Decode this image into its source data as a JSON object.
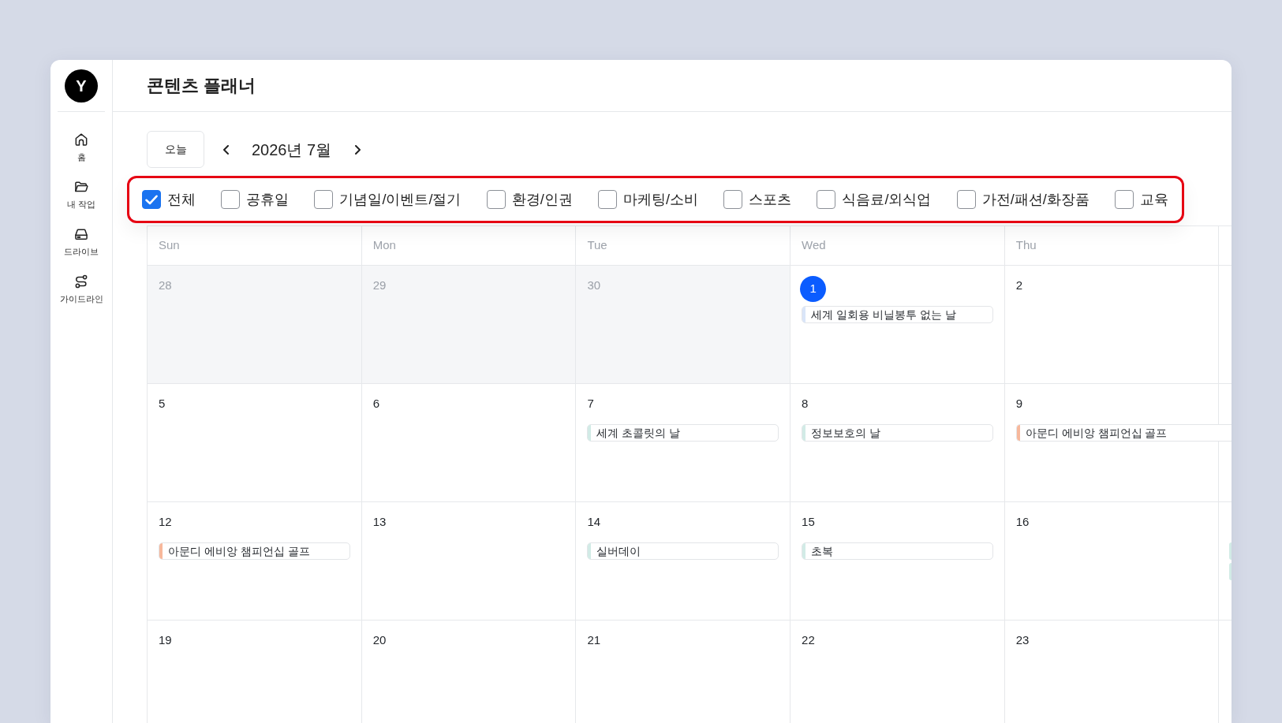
{
  "sidebar": {
    "avatar": "Y",
    "items": [
      {
        "label": "홈"
      },
      {
        "label": "내 작업"
      },
      {
        "label": "드라이브"
      },
      {
        "label": "가이드라인"
      }
    ]
  },
  "header": {
    "title": "콘텐츠 플래너"
  },
  "toolbar": {
    "today_button": "오늘",
    "month": "2026년 7월"
  },
  "filters": [
    {
      "label": "전체",
      "checked": true
    },
    {
      "label": "공휴일",
      "checked": false
    },
    {
      "label": "기념일/이벤트/절기",
      "checked": false
    },
    {
      "label": "환경/인권",
      "checked": false
    },
    {
      "label": "마케팅/소비",
      "checked": false
    },
    {
      "label": "스포츠",
      "checked": false
    },
    {
      "label": "식음료/외식업",
      "checked": false
    },
    {
      "label": "가전/패션/화장품",
      "checked": false
    },
    {
      "label": "교육",
      "checked": false
    }
  ],
  "calendar": {
    "weekdays": [
      "Sun",
      "Mon",
      "Tue",
      "Wed",
      "Thu"
    ],
    "weeks": [
      {
        "days": [
          {
            "date": "28",
            "in_month": false,
            "today": false
          },
          {
            "date": "29",
            "in_month": false,
            "today": false
          },
          {
            "date": "30",
            "in_month": false,
            "today": false
          },
          {
            "date": "1",
            "in_month": true,
            "today": true,
            "events": [
              {
                "title": "세계 일회용 비닐봉투 없는 날",
                "color": "#d9e5f8",
                "continues": false
              }
            ]
          },
          {
            "date": "2",
            "in_month": true,
            "today": false
          }
        ]
      },
      {
        "days": [
          {
            "date": "5",
            "in_month": true,
            "today": false
          },
          {
            "date": "6",
            "in_month": true,
            "today": false
          },
          {
            "date": "7",
            "in_month": true,
            "today": false,
            "events": [
              {
                "title": "세계 초콜릿의 날",
                "color": "#d2ebe6",
                "continues": false
              }
            ]
          },
          {
            "date": "8",
            "in_month": true,
            "today": false,
            "events": [
              {
                "title": "정보보호의 날",
                "color": "#d2ebe6",
                "continues": false
              }
            ]
          },
          {
            "date": "9",
            "in_month": true,
            "today": false,
            "events": [
              {
                "title": "아문디 에비앙 챔피언십 골프",
                "color": "#f7b89c",
                "continues": true
              }
            ]
          }
        ]
      },
      {
        "days": [
          {
            "date": "12",
            "in_month": true,
            "today": false,
            "events": [
              {
                "title": "아문디 에비앙 챔피언십 골프",
                "color": "#f7b89c",
                "continues": false
              }
            ]
          },
          {
            "date": "13",
            "in_month": true,
            "today": false
          },
          {
            "date": "14",
            "in_month": true,
            "today": false,
            "events": [
              {
                "title": "실버데이",
                "color": "#d2ebe6",
                "continues": false
              }
            ]
          },
          {
            "date": "15",
            "in_month": true,
            "today": false,
            "events": [
              {
                "title": "초복",
                "color": "#d2ebe6",
                "continues": false
              }
            ]
          },
          {
            "date": "16",
            "in_month": true,
            "today": false
          }
        ],
        "next_column_events": [
          {
            "color": "#d2ebe6"
          },
          {
            "color": "#d2ebe6"
          }
        ]
      },
      {
        "days": [
          {
            "date": "19",
            "in_month": true,
            "today": false
          },
          {
            "date": "20",
            "in_month": true,
            "today": false
          },
          {
            "date": "21",
            "in_month": true,
            "today": false
          },
          {
            "date": "22",
            "in_month": true,
            "today": false
          },
          {
            "date": "23",
            "in_month": true,
            "today": false
          }
        ]
      }
    ]
  }
}
